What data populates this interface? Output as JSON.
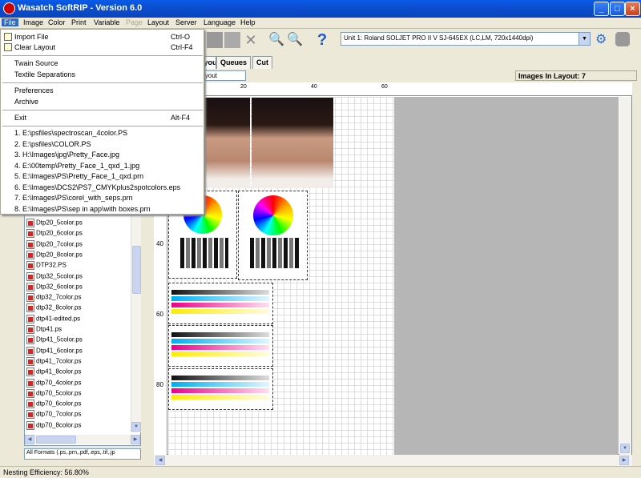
{
  "window": {
    "title": "Wasatch SoftRIP  - Version 6.0"
  },
  "menubar": [
    "File",
    "Image",
    "Color",
    "Print",
    "Variable",
    "Page",
    "Layout",
    "Server",
    "Language",
    "Help"
  ],
  "file_menu": {
    "items": [
      {
        "label": "Import File",
        "shortcut": "Ctrl-O"
      },
      {
        "label": "Clear Layout",
        "shortcut": "Ctrl-F4"
      },
      {
        "label": "Twain Source",
        "shortcut": ""
      },
      {
        "label": "Textile Separations",
        "shortcut": ""
      },
      {
        "label": "Preferences",
        "shortcut": ""
      },
      {
        "label": "Archive",
        "shortcut": ""
      },
      {
        "label": "Exit",
        "shortcut": "Alt-F4"
      }
    ],
    "recent": [
      "1. E:\\psfiles\\spectroscan_4color.PS",
      "2. E:\\psfiles\\COLOR.PS",
      "3. H:\\Images\\jpg\\Pretty_Face.jpg",
      "4. E:\\00temp\\Pretty_Face_1_qxd_1.jpg",
      "5. E:\\Images\\PS\\Pretty_Face_1_qxd.prn",
      "6. E:\\Images\\DCS2\\PS7_CMYKplus2spotcolors.eps",
      "7. E:\\Images\\PS\\corel_with_seps.prn",
      "8. E:\\Images\\PS\\sep in app\\with boxes.prn"
    ]
  },
  "toolbar": {
    "unit_selector": "Unit 1: Roland  SOLJET PRO II V SJ-645EX (LC,LM, 720x1440dpi)"
  },
  "tabs": [
    "Layout",
    "Queues",
    "Cut"
  ],
  "layout": {
    "field_value": "Layout",
    "images_in_layout": "Images In Layout: 7"
  },
  "file_list": [
    "Dtp20_5color.ps",
    "Dtp20_6color.ps",
    "Dtp20_7color.ps",
    "Dtp20_8color.ps",
    "DTP32.PS",
    "Dtp32_5color.ps",
    "Dtp32_6color.ps",
    "dtp32_7color.ps",
    "dtp32_8color.ps",
    "dtp41-edited.ps",
    "Dtp41.ps",
    "Dtp41_5color.ps",
    "Dtp41_6color.ps",
    "dtp41_7color.ps",
    "dtp41_8color.ps",
    "dtp70_4color.ps",
    "dtp70_5color.ps",
    "dtp70_6color.ps",
    "dtp70_7color.ps",
    "dtp70_8color.ps"
  ],
  "format_filter": "All Formats (.ps,.prn,.pdf,.eps,.tif,.jp",
  "ruler": {
    "h_labels": [
      "20",
      "40",
      "60"
    ],
    "v_labels": [
      "40",
      "60",
      "80"
    ]
  },
  "status": {
    "nesting": "Nesting Efficiency: 56.80%"
  }
}
